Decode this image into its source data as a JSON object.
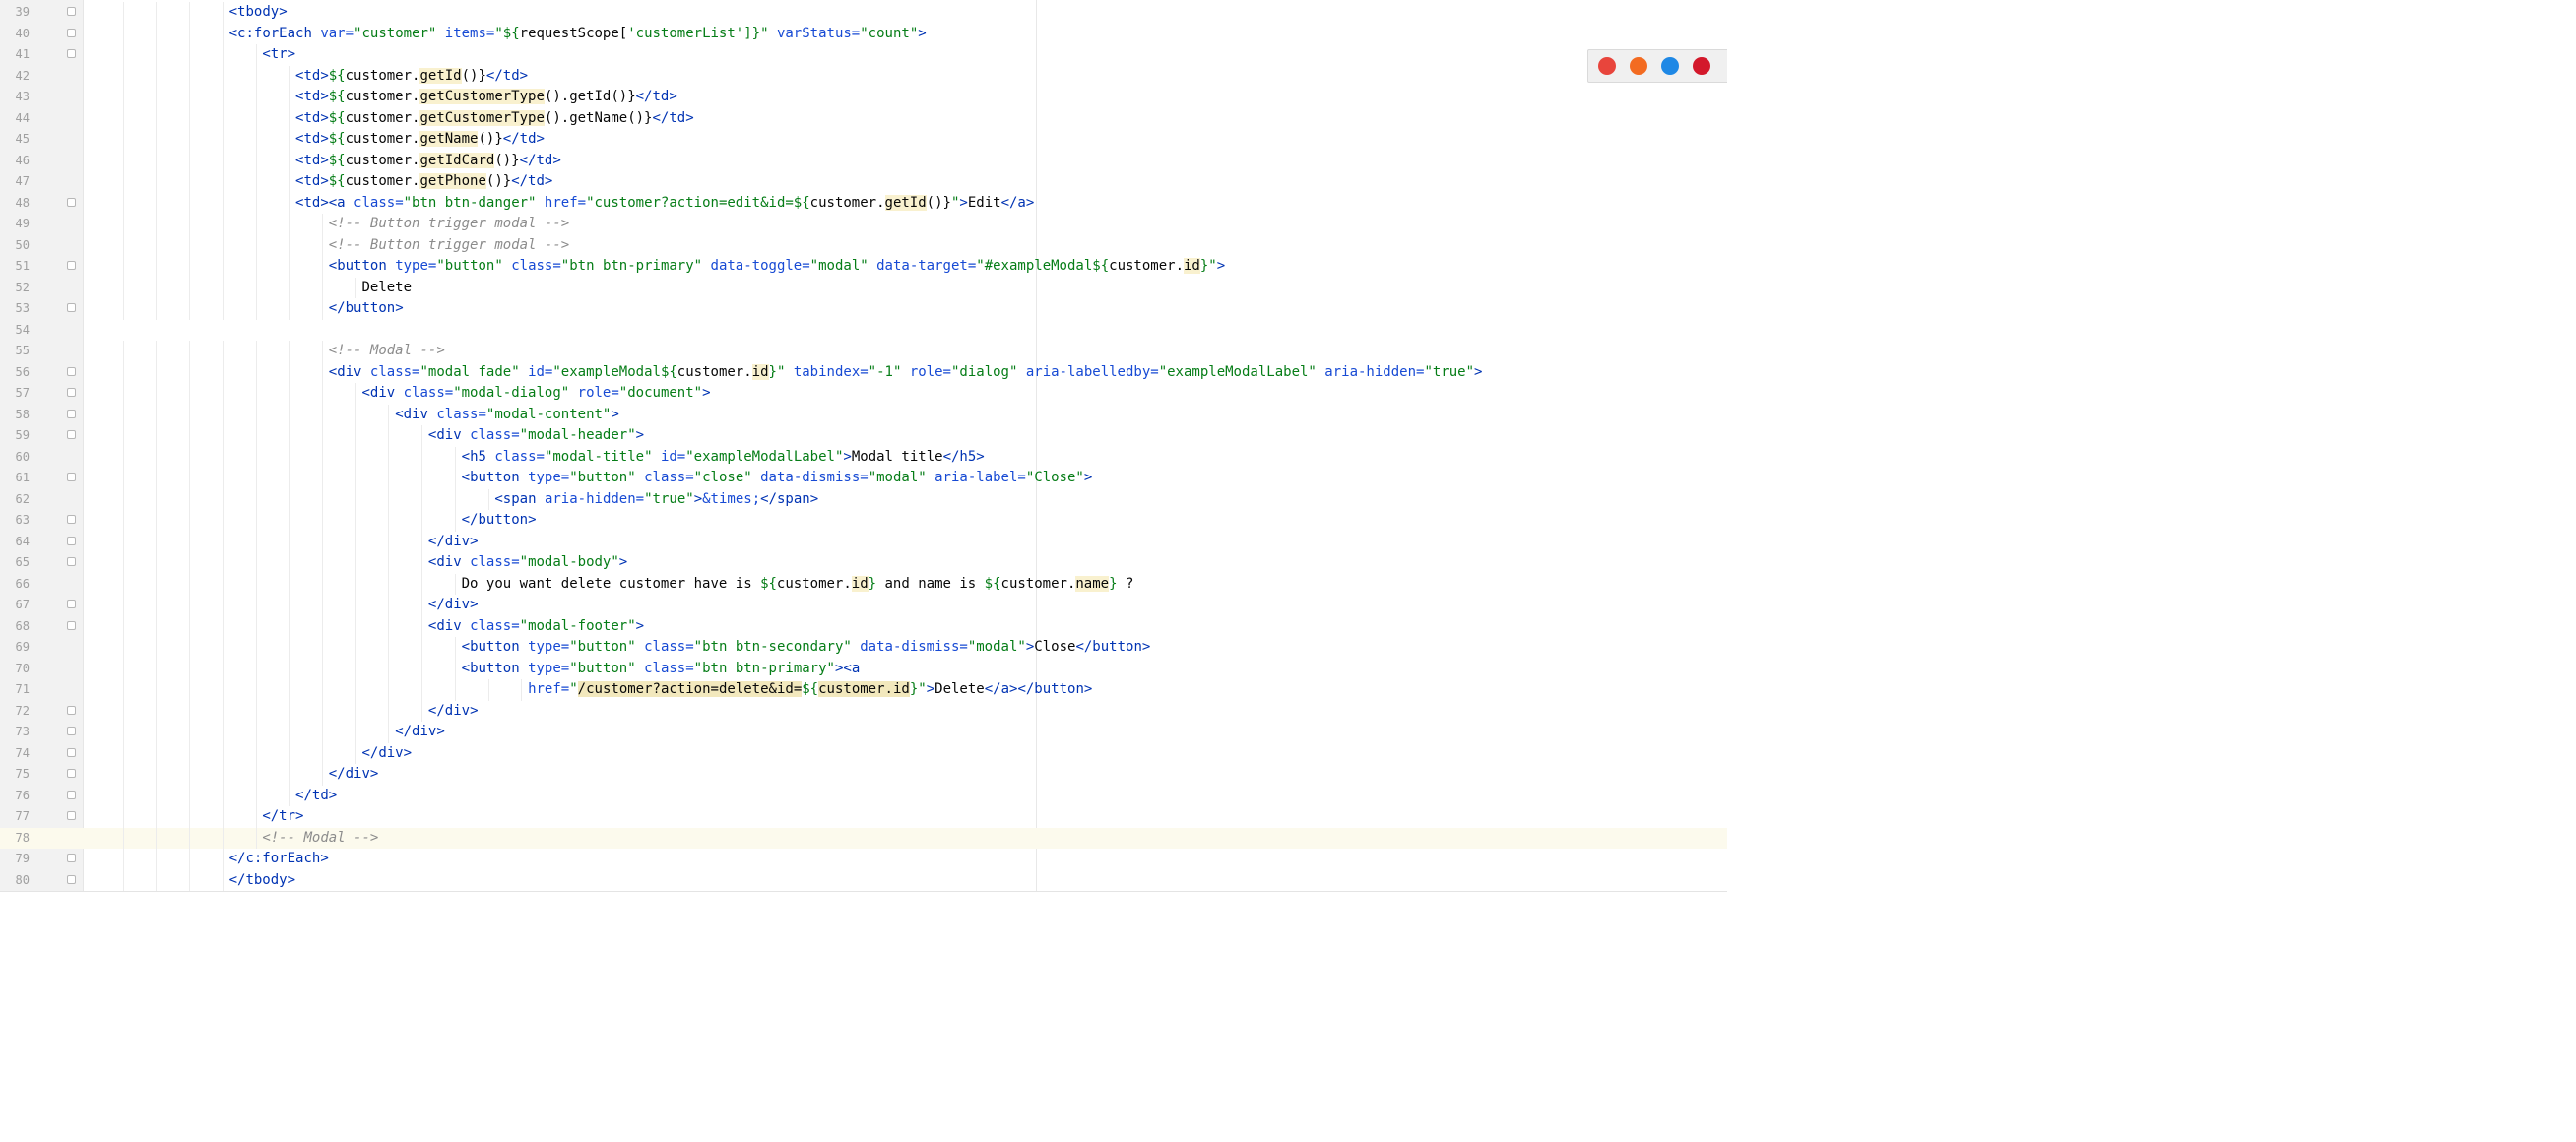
{
  "editor": {
    "lines": [
      {
        "n": "39",
        "indent": 5,
        "tokens": [
          [
            "<",
            "tag"
          ],
          [
            "tbody",
            "tag"
          ],
          [
            ">",
            "tag"
          ]
        ]
      },
      {
        "n": "40",
        "indent": 5,
        "tokens": [
          [
            "<",
            "tag"
          ],
          [
            "c:forEach ",
            "tag"
          ],
          [
            "var=",
            "attr"
          ],
          [
            "\"customer\" ",
            "str"
          ],
          [
            "items=",
            "attr"
          ],
          [
            "\"${",
            "str"
          ],
          [
            "requestScope[",
            "id"
          ],
          [
            "'customerList'",
            "str"
          ],
          [
            "]}\" ",
            "str"
          ],
          [
            "varStatus=",
            "attr"
          ],
          [
            "\"count\"",
            "str"
          ],
          [
            ">",
            "tag"
          ]
        ]
      },
      {
        "n": "41",
        "indent": 6,
        "tokens": [
          [
            "<",
            "tag"
          ],
          [
            "tr",
            "tag"
          ],
          [
            ">",
            "tag"
          ]
        ]
      },
      {
        "n": "42",
        "indent": 7,
        "tokens": [
          [
            "<td>",
            "tag"
          ],
          [
            "${",
            "str"
          ],
          [
            "customer.",
            "id"
          ],
          [
            "getId",
            "hl"
          ],
          [
            "()}",
            "id"
          ],
          [
            "</td>",
            "tag"
          ]
        ]
      },
      {
        "n": "43",
        "indent": 7,
        "tokens": [
          [
            "<td>",
            "tag"
          ],
          [
            "${",
            "str"
          ],
          [
            "customer.",
            "id"
          ],
          [
            "getCustomerType",
            "hl"
          ],
          [
            "().getId()}",
            "id"
          ],
          [
            "</td>",
            "tag"
          ]
        ]
      },
      {
        "n": "44",
        "indent": 7,
        "tokens": [
          [
            "<td>",
            "tag"
          ],
          [
            "${",
            "str"
          ],
          [
            "customer.",
            "id"
          ],
          [
            "getCustomerType",
            "hl"
          ],
          [
            "().getName()}",
            "id"
          ],
          [
            "</td>",
            "tag"
          ]
        ]
      },
      {
        "n": "45",
        "indent": 7,
        "tokens": [
          [
            "<td>",
            "tag"
          ],
          [
            "${",
            "str"
          ],
          [
            "customer.",
            "id"
          ],
          [
            "getName",
            "hl"
          ],
          [
            "()}",
            "id"
          ],
          [
            "</td>",
            "tag"
          ]
        ]
      },
      {
        "n": "46",
        "indent": 7,
        "tokens": [
          [
            "<td>",
            "tag"
          ],
          [
            "${",
            "str"
          ],
          [
            "customer.",
            "id"
          ],
          [
            "getIdCard",
            "hl"
          ],
          [
            "()}",
            "id"
          ],
          [
            "</td>",
            "tag"
          ]
        ]
      },
      {
        "n": "47",
        "indent": 7,
        "tokens": [
          [
            "<td>",
            "tag"
          ],
          [
            "${",
            "str"
          ],
          [
            "customer.",
            "id"
          ],
          [
            "getPhone",
            "hl"
          ],
          [
            "()}",
            "id"
          ],
          [
            "</td>",
            "tag"
          ]
        ]
      },
      {
        "n": "48",
        "indent": 7,
        "tokens": [
          [
            "<td>",
            "tag"
          ],
          [
            "<a ",
            "tag"
          ],
          [
            "class=",
            "attr"
          ],
          [
            "\"btn btn-danger\" ",
            "str"
          ],
          [
            "href=",
            "attr"
          ],
          [
            "\"customer?action=edit&id=",
            "str"
          ],
          [
            "${",
            "str"
          ],
          [
            "customer.",
            "id"
          ],
          [
            "getId",
            "hl"
          ],
          [
            "()}",
            "id"
          ],
          [
            "\"",
            "str"
          ],
          [
            ">",
            "tag"
          ],
          [
            "Edit",
            "id"
          ],
          [
            "</a>",
            "tag"
          ]
        ]
      },
      {
        "n": "49",
        "indent": 8,
        "tokens": [
          [
            "<!-- Button trigger modal -->",
            "com"
          ]
        ]
      },
      {
        "n": "50",
        "indent": 8,
        "tokens": [
          [
            "<!-- Button trigger modal -->",
            "com"
          ]
        ]
      },
      {
        "n": "51",
        "indent": 8,
        "tokens": [
          [
            "<",
            "tag"
          ],
          [
            "button ",
            "tag"
          ],
          [
            "type=",
            "attr"
          ],
          [
            "\"button\" ",
            "str"
          ],
          [
            "class=",
            "attr"
          ],
          [
            "\"btn btn-primary\" ",
            "str"
          ],
          [
            "data-toggle=",
            "attr"
          ],
          [
            "\"modal\" ",
            "str"
          ],
          [
            "data-target=",
            "attr"
          ],
          [
            "\"#exampleModal",
            "str"
          ],
          [
            "${",
            "str"
          ],
          [
            "customer.",
            "id"
          ],
          [
            "id",
            "hl"
          ],
          [
            "}\"",
            "str"
          ],
          [
            ">",
            "tag"
          ]
        ]
      },
      {
        "n": "52",
        "indent": 9,
        "tokens": [
          [
            "Delete",
            "id"
          ]
        ]
      },
      {
        "n": "53",
        "indent": 8,
        "tokens": [
          [
            "</",
            "tag"
          ],
          [
            "button",
            "tag"
          ],
          [
            ">",
            "tag"
          ]
        ]
      },
      {
        "n": "54",
        "indent": 0,
        "tokens": []
      },
      {
        "n": "55",
        "indent": 8,
        "tokens": [
          [
            "<!-- Modal -->",
            "com"
          ]
        ]
      },
      {
        "n": "56",
        "indent": 8,
        "tokens": [
          [
            "<",
            "tag"
          ],
          [
            "div ",
            "tag"
          ],
          [
            "class=",
            "attr"
          ],
          [
            "\"modal fade\" ",
            "str"
          ],
          [
            "id=",
            "attr"
          ],
          [
            "\"exampleModal",
            "str"
          ],
          [
            "${",
            "str"
          ],
          [
            "customer.",
            "id"
          ],
          [
            "id",
            "hl"
          ],
          [
            "}\" ",
            "str"
          ],
          [
            "tabindex=",
            "attr"
          ],
          [
            "\"-1\" ",
            "str"
          ],
          [
            "role=",
            "attr"
          ],
          [
            "\"dialog\" ",
            "str"
          ],
          [
            "aria-labelledby=",
            "attr"
          ],
          [
            "\"exampleModalLabel\" ",
            "str"
          ],
          [
            "aria-hidden=",
            "attr"
          ],
          [
            "\"true\"",
            "str"
          ],
          [
            ">",
            "tag"
          ]
        ]
      },
      {
        "n": "57",
        "indent": 9,
        "tokens": [
          [
            "<",
            "tag"
          ],
          [
            "div ",
            "tag"
          ],
          [
            "class=",
            "attr"
          ],
          [
            "\"modal-dialog\" ",
            "str"
          ],
          [
            "role=",
            "attr"
          ],
          [
            "\"document\"",
            "str"
          ],
          [
            ">",
            "tag"
          ]
        ]
      },
      {
        "n": "58",
        "indent": 10,
        "tokens": [
          [
            "<",
            "tag"
          ],
          [
            "div ",
            "tag"
          ],
          [
            "class=",
            "attr"
          ],
          [
            "\"modal-content\"",
            "str"
          ],
          [
            ">",
            "tag"
          ]
        ]
      },
      {
        "n": "59",
        "indent": 11,
        "tokens": [
          [
            "<",
            "tag"
          ],
          [
            "div ",
            "tag"
          ],
          [
            "class=",
            "attr"
          ],
          [
            "\"modal-header\"",
            "str"
          ],
          [
            ">",
            "tag"
          ]
        ]
      },
      {
        "n": "60",
        "indent": 12,
        "tokens": [
          [
            "<",
            "tag"
          ],
          [
            "h5 ",
            "tag"
          ],
          [
            "class=",
            "attr"
          ],
          [
            "\"modal-title\" ",
            "str"
          ],
          [
            "id=",
            "attr"
          ],
          [
            "\"exampleModalLabel\"",
            "str"
          ],
          [
            ">",
            "tag"
          ],
          [
            "Modal title",
            "id"
          ],
          [
            "</h5>",
            "tag"
          ]
        ]
      },
      {
        "n": "61",
        "indent": 12,
        "tokens": [
          [
            "<",
            "tag"
          ],
          [
            "button ",
            "tag"
          ],
          [
            "type=",
            "attr"
          ],
          [
            "\"button\" ",
            "str"
          ],
          [
            "class=",
            "attr"
          ],
          [
            "\"close\" ",
            "str"
          ],
          [
            "data-dismiss=",
            "attr"
          ],
          [
            "\"modal\" ",
            "str"
          ],
          [
            "aria-label=",
            "attr"
          ],
          [
            "\"Close\"",
            "str"
          ],
          [
            ">",
            "tag"
          ]
        ]
      },
      {
        "n": "62",
        "indent": 13,
        "tokens": [
          [
            "<",
            "tag"
          ],
          [
            "span ",
            "tag"
          ],
          [
            "aria-hidden=",
            "attr"
          ],
          [
            "\"true\"",
            "str"
          ],
          [
            ">",
            "tag"
          ],
          [
            "&times;",
            "attr"
          ],
          [
            "</span>",
            "tag"
          ]
        ]
      },
      {
        "n": "63",
        "indent": 12,
        "tokens": [
          [
            "</",
            "tag"
          ],
          [
            "button",
            "tag"
          ],
          [
            ">",
            "tag"
          ]
        ]
      },
      {
        "n": "64",
        "indent": 11,
        "tokens": [
          [
            "</",
            "tag"
          ],
          [
            "div",
            "tag"
          ],
          [
            ">",
            "tag"
          ]
        ]
      },
      {
        "n": "65",
        "indent": 11,
        "tokens": [
          [
            "<",
            "tag"
          ],
          [
            "div ",
            "tag"
          ],
          [
            "class=",
            "attr"
          ],
          [
            "\"modal-body\"",
            "str"
          ],
          [
            ">",
            "tag"
          ]
        ]
      },
      {
        "n": "66",
        "indent": 12,
        "tokens": [
          [
            "Do you want delete customer have is ",
            "id"
          ],
          [
            "${",
            "str"
          ],
          [
            "customer.",
            "id"
          ],
          [
            "id",
            "hl"
          ],
          [
            "}",
            "str"
          ],
          [
            " and name is ",
            "id"
          ],
          [
            "${",
            "str"
          ],
          [
            "customer.",
            "id"
          ],
          [
            "name",
            "hl"
          ],
          [
            "}",
            "str"
          ],
          [
            " ?",
            "id"
          ]
        ]
      },
      {
        "n": "67",
        "indent": 11,
        "tokens": [
          [
            "</",
            "tag"
          ],
          [
            "div",
            "tag"
          ],
          [
            ">",
            "tag"
          ]
        ]
      },
      {
        "n": "68",
        "indent": 11,
        "tokens": [
          [
            "<",
            "tag"
          ],
          [
            "div ",
            "tag"
          ],
          [
            "class=",
            "attr"
          ],
          [
            "\"modal-footer\"",
            "str"
          ],
          [
            ">",
            "tag"
          ]
        ]
      },
      {
        "n": "69",
        "indent": 12,
        "tokens": [
          [
            "<",
            "tag"
          ],
          [
            "button ",
            "tag"
          ],
          [
            "type=",
            "attr"
          ],
          [
            "\"button\" ",
            "str"
          ],
          [
            "class=",
            "attr"
          ],
          [
            "\"btn btn-secondary\" ",
            "str"
          ],
          [
            "data-dismiss=",
            "attr"
          ],
          [
            "\"modal\"",
            "str"
          ],
          [
            ">",
            "tag"
          ],
          [
            "Close",
            "id"
          ],
          [
            "</button>",
            "tag"
          ]
        ]
      },
      {
        "n": "70",
        "indent": 12,
        "tokens": [
          [
            "<",
            "tag"
          ],
          [
            "button ",
            "tag"
          ],
          [
            "type=",
            "attr"
          ],
          [
            "\"button\" ",
            "str"
          ],
          [
            "class=",
            "attr"
          ],
          [
            "\"btn btn-primary\"",
            "str"
          ],
          [
            ">",
            "tag"
          ],
          [
            "<a",
            "tag"
          ]
        ]
      },
      {
        "n": "71",
        "indent": 14,
        "tokens": [
          [
            "href=",
            "attr"
          ],
          [
            "\"",
            "str"
          ],
          [
            "/customer?action=delete&id=",
            "hl2"
          ],
          [
            "${",
            "str"
          ],
          [
            "customer.id",
            "hl2"
          ],
          [
            "}",
            "str"
          ],
          [
            "\"",
            "str"
          ],
          [
            ">",
            "tag"
          ],
          [
            "Delete",
            "id"
          ],
          [
            "</a>",
            "tag"
          ],
          [
            "</button>",
            "tag"
          ]
        ]
      },
      {
        "n": "72",
        "indent": 11,
        "tokens": [
          [
            "</",
            "tag"
          ],
          [
            "div",
            "tag"
          ],
          [
            ">",
            "tag"
          ]
        ]
      },
      {
        "n": "73",
        "indent": 10,
        "tokens": [
          [
            "</",
            "tag"
          ],
          [
            "div",
            "tag"
          ],
          [
            ">",
            "tag"
          ]
        ]
      },
      {
        "n": "74",
        "indent": 9,
        "tokens": [
          [
            "</",
            "tag"
          ],
          [
            "div",
            "tag"
          ],
          [
            ">",
            "tag"
          ]
        ]
      },
      {
        "n": "75",
        "indent": 8,
        "tokens": [
          [
            "</",
            "tag"
          ],
          [
            "div",
            "tag"
          ],
          [
            ">",
            "tag"
          ]
        ]
      },
      {
        "n": "76",
        "indent": 7,
        "tokens": [
          [
            "</",
            "tag"
          ],
          [
            "td",
            "tag"
          ],
          [
            ">",
            "tag"
          ]
        ]
      },
      {
        "n": "77",
        "indent": 6,
        "tokens": [
          [
            "</",
            "tag"
          ],
          [
            "tr",
            "tag"
          ],
          [
            ">",
            "tag"
          ]
        ]
      },
      {
        "n": "78",
        "indent": 6,
        "current": true,
        "tokens": [
          [
            "<!-- Modal -->",
            "com"
          ]
        ]
      },
      {
        "n": "79",
        "indent": 5,
        "tokens": [
          [
            "</",
            "tag"
          ],
          [
            "c:forEach",
            "tag"
          ],
          [
            ">",
            "tag"
          ]
        ]
      },
      {
        "n": "80",
        "indent": 5,
        "tokens": [
          [
            "</",
            "tag"
          ],
          [
            "tbody",
            "tag"
          ],
          [
            ">",
            "tag"
          ]
        ]
      }
    ]
  },
  "browser_icons": [
    {
      "name": "chrome-icon",
      "color": "#e8453c"
    },
    {
      "name": "firefox-icon",
      "color": "#f36b21"
    },
    {
      "name": "safari-icon",
      "color": "#1e88e5"
    },
    {
      "name": "opera-icon",
      "color": "#d3182b"
    }
  ]
}
